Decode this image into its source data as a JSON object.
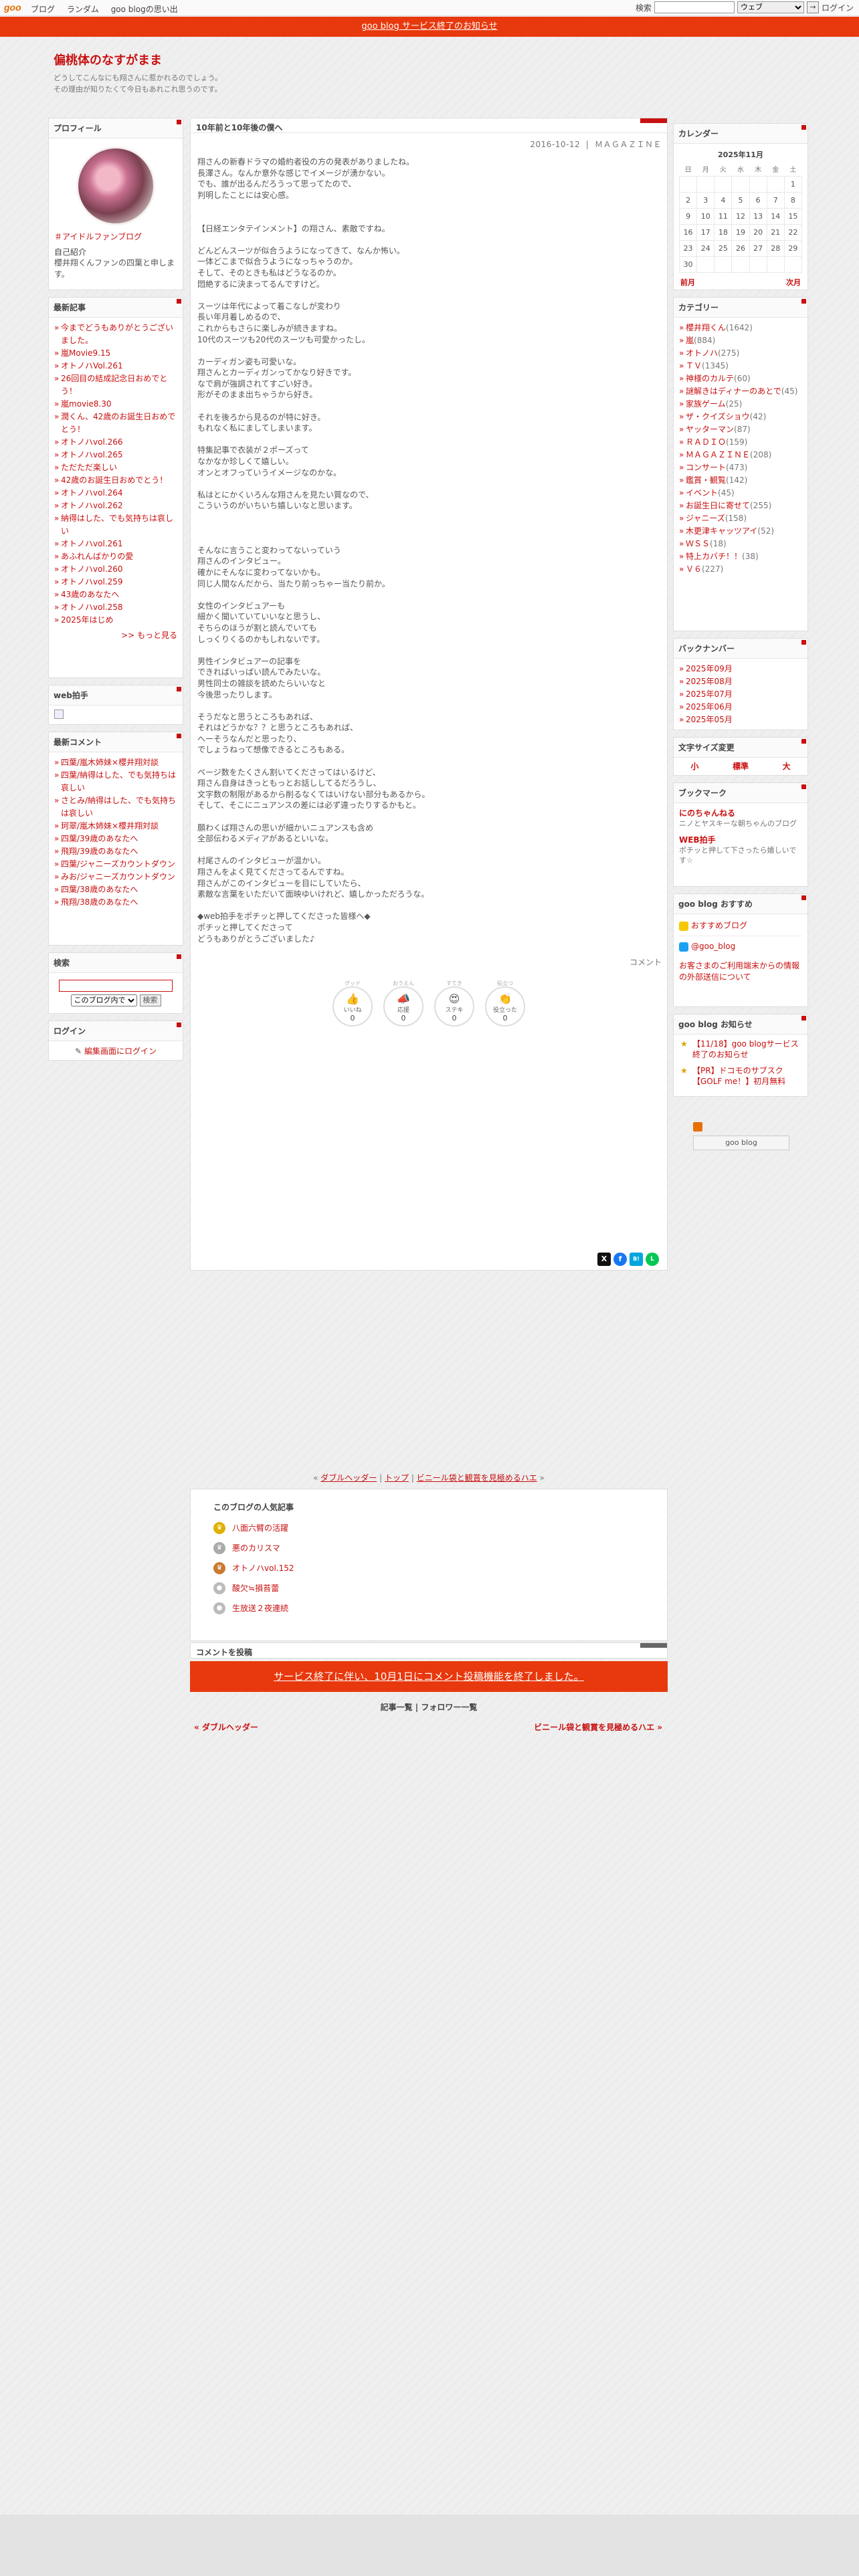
{
  "topbar": {
    "logo": "goo",
    "links": [
      "ブログ",
      "ランダム",
      "goo blogの思い出"
    ],
    "search_label": "検索",
    "search_select": "ウェブ",
    "search_btn": "→",
    "login": "ログイン"
  },
  "notice": "goo blog サービス終了のお知らせ",
  "header": {
    "title": "偏桃体のなすがまま",
    "desc_1": "どうしてこんなにも翔さんに惹かれるのでしょう。",
    "desc_2": "その理由が知りたくて今日もあれこれ思うのです。"
  },
  "profile": {
    "heading": "プロフィール",
    "link": "＃アイドルファンブログ",
    "intro_label": "自己紹介",
    "intro": "櫻井翔くんファンの四葉と申します。"
  },
  "recent": {
    "heading": "最新記事",
    "items": [
      "今までどうもありがとうございました。",
      "嵐Movie9.15",
      "オトノハVol.261",
      "26回目の結成記念日おめでとう！",
      "嵐movie8.30",
      "潤くん、42歳のお誕生日おめでとう！",
      "オトノハvol.266",
      "オトノハvol.265",
      "ただただ楽しい",
      "42歳のお誕生日おめでとう！",
      "オトノハvol.264",
      "オトノハvol.262",
      "納得はした、でも気持ちは哀しい",
      "オトノハvol.261",
      "あふれんばかりの愛",
      "オトノハvol.260",
      "オトノハvol.259",
      "43歳のあなたへ",
      "オトノハvol.258",
      "2025年はじめ"
    ],
    "more": ">> もっと見る"
  },
  "clap": {
    "heading": "web拍手"
  },
  "comments": {
    "heading": "最新コメント",
    "items": [
      "四葉/嵐木姉妹×櫻井翔対談",
      "四葉/納得はした、でも気持ちは哀しい",
      "さとみ/納得はした、でも気持ちは哀しい",
      "珂翠/嵐木姉妹×櫻井翔対談",
      "四葉/39歳のあなたへ",
      "飛翔/39歳のあなたへ",
      "四葉/ジャニーズカウントダウン",
      "みお/ジャニーズカウントダウン",
      "四葉/38歳のあなたへ",
      "飛翔/38歳のあなたへ"
    ]
  },
  "search_box": {
    "heading": "検索",
    "select": "このブログ内で",
    "button": "検索"
  },
  "login_box": {
    "heading": "ログイン",
    "link": "編集画面にログイン"
  },
  "article": {
    "title": "10年前と10年後の僕へ",
    "date": "2016-10-12",
    "category": "ＭＡＧＡＺＩＮＥ",
    "paragraphs": [
      "翔さんの新春ドラマの婚約者役の方の発表がありましたね。\n長澤さん。なんか意外な感じでイメージが湧かない。\nでも、誰が出るんだろうって思ってたので、\n判明したことには安心感。",
      "",
      "",
      "【日経エンタテインメント】の翔さん、素敵ですね。",
      "",
      "どんどんスーツが似合うようになってきて、なんか怖い。\n一体どこまで似合うようになっちゃうのか。\nそして、そのときも私はどうなるのか。\n悶絶するに決まってるんですけど。",
      "",
      "スーツは年代によって着こなしが変わり\n長い年月着しめるので、\nこれからもさらに楽しみが続きますね。\n10代のスーツも20代のスーツも可愛かったし。",
      "",
      "カーディガン姿も可愛いな。\n翔さんとカーディガンってかなり好きです。\nなで肩が強調されてすごい好き。\n形がそのまま出ちゃうから好き。",
      "",
      "それを後ろから見るのが特に好き。\nもれなく私にましてしまいます。",
      "",
      "特集記事で衣装が２ポーズって\nなかなか珍しくて嬉しい。\nオンとオフっていうイメージなのかな。",
      "",
      "私はとにかくいろんな翔さんを見たい質なので、\nこういうのがいちいち嬉しいなと思います。",
      "",
      "",
      "",
      "そんなに言うこと変わってないっていう\n翔さんのインタビュー。\n確かにそんなに変わってないかも。\n同じ人間なんだから、当たり前っちゃー当たり前か。",
      "",
      "女性のインタビュアーも\n細かく聞いていていいなと思うし、\nそちらのほうが割と読んでいても\nしっくりくるのかもしれないです。",
      "",
      "男性インタビュアーの記事を\nできればいっぱい読んでみたいな。\n男性同士の雑談を読めたらいいなと\n今後思ったりします。",
      "",
      "そうだなと思うところもあれば、\nそれはどうかな？？と思うところもあれば、\nへーそうなんだと思ったり、\nでしょうねって想像できるところもある。",
      "",
      "ページ数をたくさん割いてくださってはいるけど、\n翔さん自身はきっともっとお話ししてるだろうし、\n文字数の制限があるから削るなくてはいけない部分もあるから。\nそして、そこにニュアンスの差には必ず違ったりするかもと。",
      "",
      "願わくば翔さんの思いが細かいニュアンスも含め\n全部伝わるメディアがあるといいな。",
      "",
      "村尾さんのインタビューが温かい。\n翔さんをよく見てくださってるんですね。\n翔さんがこのインタビューを目にしていたら、\n素敵な言葉をいただいて面映ゆいけれど、嬉しかっただろうな。",
      "",
      "◆web拍手をポチッと押してくださった皆様へ◆\nポチッと押してくださって\nどうもありがとうございました♪"
    ],
    "comment_link": "コメント",
    "reactions": [
      {
        "top": "グッド",
        "label": "いいね",
        "count": "0"
      },
      {
        "top": "おうえん",
        "label": "応援",
        "count": "0"
      },
      {
        "top": "すてき",
        "label": "ステキ",
        "count": "0"
      },
      {
        "top": "役立つ",
        "label": "役立った",
        "count": "0"
      }
    ],
    "share": [
      "X",
      "f",
      "B!",
      "L"
    ]
  },
  "nav": {
    "prev": "ダブルヘッダー",
    "top": "トップ",
    "next": "ビニール袋と観賞を見極めるハエ"
  },
  "popular": {
    "heading": "このブログの人気記事",
    "items": [
      "八面六臂の活躍",
      "悪のカリスマ",
      "オトノハvol.152",
      "酸欠≒損苔蕾",
      "生放送２夜連続"
    ]
  },
  "comment_post": {
    "heading": "コメントを投稿",
    "closed": "サービス終了に伴い、10月1日にコメント投稿機能を終了しました。"
  },
  "footer": {
    "links": "記事一覧 | フォロワー一覧",
    "prev": "« ダブルヘッダー",
    "next": "ビニール袋と観賞を見極めるハエ »"
  },
  "calendar": {
    "heading": "カレンダー",
    "month": "2025年11月",
    "weekdays": [
      "日",
      "月",
      "火",
      "水",
      "木",
      "金",
      "土"
    ],
    "weeks": [
      [
        "",
        "",
        "",
        "",
        "",
        "",
        "1"
      ],
      [
        "2",
        "3",
        "4",
        "5",
        "6",
        "7",
        "8"
      ],
      [
        "9",
        "10",
        "11",
        "12",
        "13",
        "14",
        "15"
      ],
      [
        "16",
        "17",
        "18",
        "19",
        "20",
        "21",
        "22"
      ],
      [
        "23",
        "24",
        "25",
        "26",
        "27",
        "28",
        "29"
      ],
      [
        "30",
        "",
        "",
        "",
        "",
        "",
        ""
      ]
    ],
    "prev": "前月",
    "next": "次月"
  },
  "categories": {
    "heading": "カテゴリー",
    "items": [
      {
        "name": "櫻井翔くん",
        "count": "(1642)"
      },
      {
        "name": "嵐",
        "count": "(884)"
      },
      {
        "name": "オトノハ",
        "count": "(275)"
      },
      {
        "name": "ＴＶ",
        "count": "(1345)"
      },
      {
        "name": "神様のカルテ",
        "count": "(60)"
      },
      {
        "name": "謎解きはディナーのあとで",
        "count": "(45)"
      },
      {
        "name": "家族ゲーム",
        "count": "(25)"
      },
      {
        "name": "ザ・クイズショウ",
        "count": "(42)"
      },
      {
        "name": "ヤッターマン",
        "count": "(87)"
      },
      {
        "name": "ＲＡＤＩＯ",
        "count": "(159)"
      },
      {
        "name": "ＭＡＧＡＺＩＮＥ",
        "count": "(208)"
      },
      {
        "name": "コンサート",
        "count": "(473)"
      },
      {
        "name": "鑑賞・観覧",
        "count": "(142)"
      },
      {
        "name": "イベント",
        "count": "(45)"
      },
      {
        "name": "お誕生日に寄せて",
        "count": "(255)"
      },
      {
        "name": "ジャニーズ",
        "count": "(158)"
      },
      {
        "name": "木更津キャッツアイ",
        "count": "(52)"
      },
      {
        "name": "ＷＳＳ",
        "count": "(18)"
      },
      {
        "name": "特上カバチ！！",
        "count": "(38)"
      },
      {
        "name": "Ｖ６",
        "count": "(227)"
      }
    ]
  },
  "backnumber": {
    "heading": "バックナンバー",
    "items": [
      "2025年09月",
      "2025年08月",
      "2025年07月",
      "2025年06月",
      "2025年05月"
    ]
  },
  "fontsize": {
    "heading": "文字サイズ変更",
    "small": "小",
    "medium": "標準",
    "large": "大"
  },
  "bookmark": {
    "heading": "ブックマーク",
    "items": [
      {
        "title": "にのちゃんねる",
        "desc": "ニノとヤスキーな朝ちゃんのブログ"
      },
      {
        "title": "WEB拍手",
        "desc": "ポチッと押して下さったら嬉しいです☆"
      }
    ]
  },
  "recommend": {
    "heading": "goo blog おすすめ",
    "items": [
      "おすすめブログ",
      "@goo_blog"
    ],
    "note": "お客さまのご利用端末からの情報の外部送信について"
  },
  "news": {
    "heading": "goo blog お知らせ",
    "items": [
      "【11/18】goo blogサービス終了のお知らせ",
      "【PR】ドコモのサブスク【GOLF me！】初月無料"
    ]
  },
  "badge": "goo blog",
  "colors": {
    "accent": "#c81010",
    "notice": "#e8380d"
  }
}
